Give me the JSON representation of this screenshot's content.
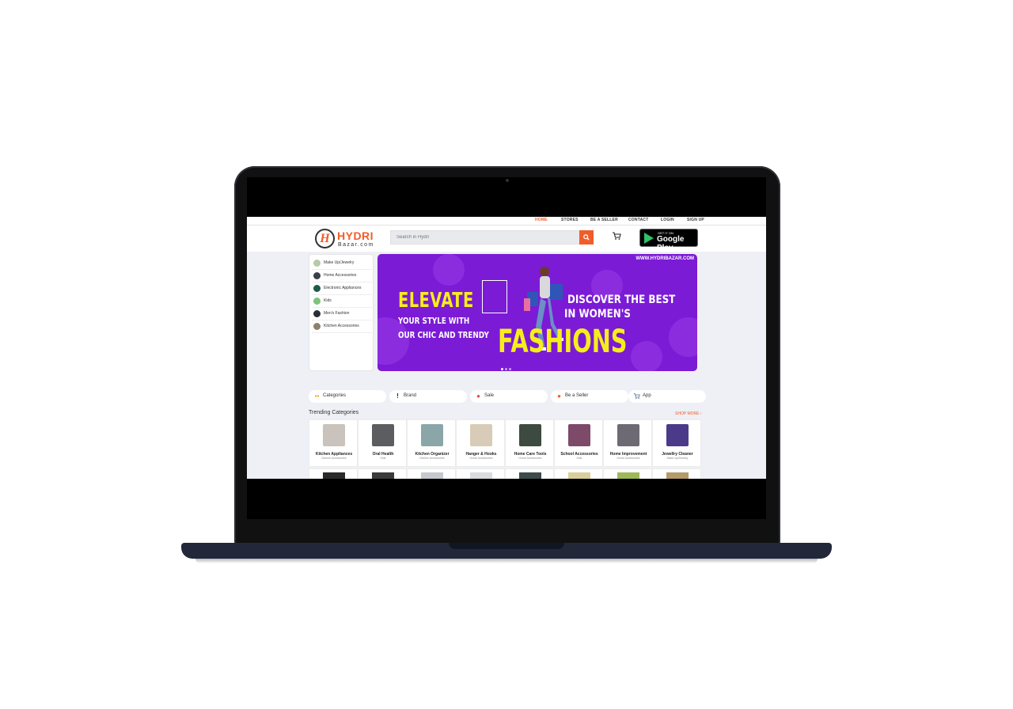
{
  "nav": {
    "items": [
      "HOME",
      "STORES",
      "BE A SELLER",
      "CONTACT",
      "LOGIN",
      "SIGN UP"
    ],
    "active": "HOME"
  },
  "logo": {
    "name": "HYDRI",
    "sub": "Bazar.com",
    "mark": "H"
  },
  "search": {
    "placeholder": "Search in Hydri"
  },
  "google_play": {
    "small": "GET IT ON",
    "big": "Google Play"
  },
  "sidebar": {
    "items": [
      {
        "label": "Make Up/Jewelry",
        "color": "#b7c9a6"
      },
      {
        "label": "Home Accessories",
        "color": "#3a3f4a"
      },
      {
        "label": "Electronic Appliances",
        "color": "#1f5a4a"
      },
      {
        "label": "Kids",
        "color": "#7cc47a"
      },
      {
        "label": "Men's Fashion",
        "color": "#2b2e35"
      },
      {
        "label": "Kitchen Accessories",
        "color": "#8f7f6e"
      }
    ]
  },
  "banner": {
    "website": "WWW.HYDRIBAZAR.COM",
    "headline": "ELEVATE",
    "line1": "YOUR STYLE WITH",
    "line2": "OUR CHIC AND TRENDY",
    "discover": "DISCOVER THE BEST",
    "women": "IN WOMEN'S",
    "fashions": "FASHIONS",
    "bg_color": "#7b1bd6",
    "accent_color": "#f5ee1a"
  },
  "pills": [
    {
      "label": "Categories",
      "icon": "grid-icon",
      "glyph": "▪▪",
      "color": "#f39c12"
    },
    {
      "label": "Brand",
      "icon": "brand-icon",
      "glyph": "!",
      "color": "#222"
    },
    {
      "label": "Sale",
      "icon": "fire-icon",
      "glyph": "●",
      "color": "#e74c3c"
    },
    {
      "label": "Be a Seller",
      "icon": "seller-icon",
      "glyph": "●",
      "color": "#f25c2a"
    },
    {
      "label": "App",
      "icon": "cart-icon",
      "glyph": "🛒",
      "color": "#7a8aa0"
    }
  ],
  "trending": {
    "title": "Trending Categories",
    "shop_more": "SHOP MORE ›",
    "items": [
      {
        "name": "Kitchen Appliances",
        "sub": "Kitchen Accessories",
        "color": "#c9c2bd"
      },
      {
        "name": "Oral Health",
        "sub": "Kids",
        "color": "#5b5d61"
      },
      {
        "name": "Kitchen Organizer",
        "sub": "Kitchen Accessories",
        "color": "#8aa6a9"
      },
      {
        "name": "Hanger & Hooks",
        "sub": "Home Accessories",
        "color": "#d8cbb7"
      },
      {
        "name": "Home Care Tools",
        "sub": "Home Accessories",
        "color": "#3d4a3f"
      },
      {
        "name": "School Accessories",
        "sub": "Kids",
        "color": "#7d4a6a"
      },
      {
        "name": "Home Improvement",
        "sub": "Home Accessories",
        "color": "#6e6a73"
      },
      {
        "name": "Jewellry Cleaner",
        "sub": "Make Up/Jewelry",
        "color": "#4b3a8a"
      }
    ],
    "second_row_colors": [
      "#2a2a2a",
      "#3a3a3a",
      "#c5c8cc",
      "#d9dbdd",
      "#3d4a4a",
      "#d8cf9a",
      "#9fb85a",
      "#b59a6a"
    ]
  },
  "colors": {
    "brand": "#f25c2a",
    "page_bg": "#eef0f5"
  }
}
